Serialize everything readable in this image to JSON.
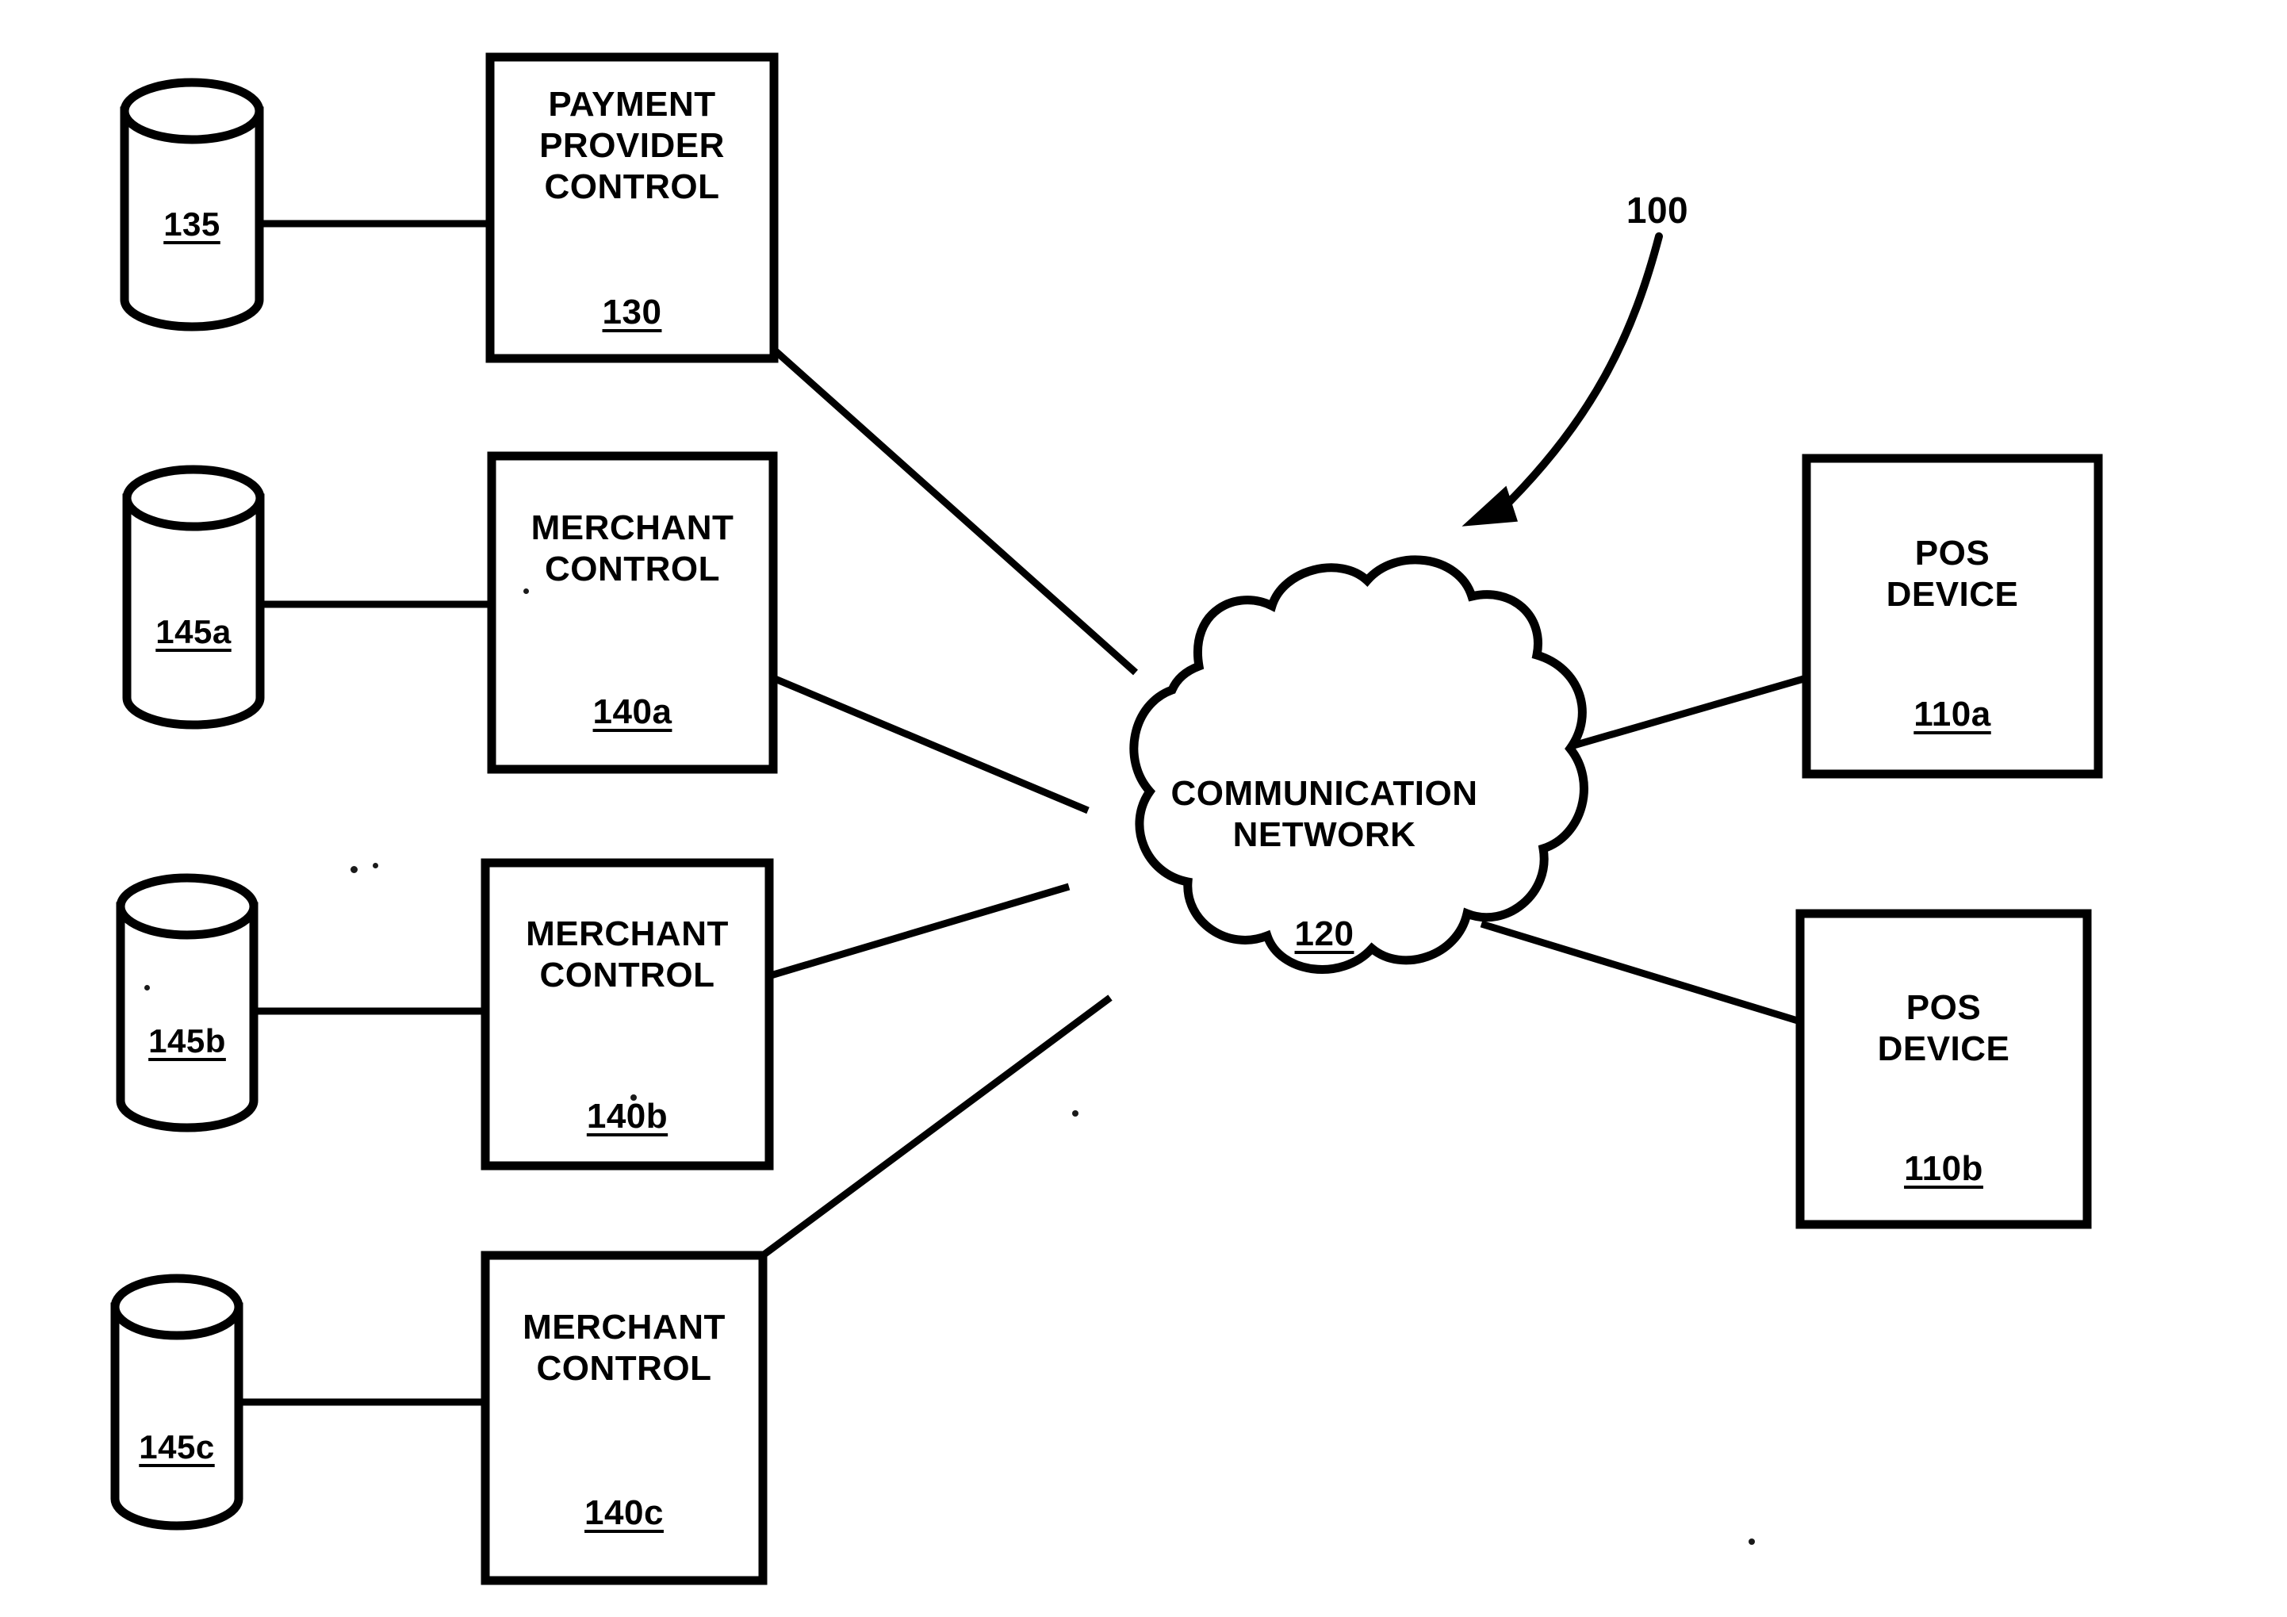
{
  "figure": {
    "reference_numeral": "100",
    "type": "system-block-diagram"
  },
  "nodes": {
    "database_135": {
      "shape": "cylinder",
      "ref": "135",
      "label": ""
    },
    "payment_provider_control": {
      "shape": "rectangle",
      "title": "PAYMENT\nPROVIDER\nCONTROL",
      "ref": "130"
    },
    "database_145a": {
      "shape": "cylinder",
      "ref": "145a",
      "label": ""
    },
    "merchant_control_a": {
      "shape": "rectangle",
      "title": "MERCHANT\nCONTROL",
      "ref": "140a"
    },
    "database_145b": {
      "shape": "cylinder",
      "ref": "145b",
      "label": ""
    },
    "merchant_control_b": {
      "shape": "rectangle",
      "title": "MERCHANT\nCONTROL",
      "ref": "140b"
    },
    "database_145c": {
      "shape": "cylinder",
      "ref": "145c",
      "label": ""
    },
    "merchant_control_c": {
      "shape": "rectangle",
      "title": "MERCHANT\nCONTROL",
      "ref": "140c"
    },
    "communication_network": {
      "shape": "cloud",
      "title": "COMMUNICATION\nNETWORK",
      "ref": "120"
    },
    "pos_device_a": {
      "shape": "rectangle",
      "title": "POS\nDEVICE",
      "ref": "110a"
    },
    "pos_device_b": {
      "shape": "rectangle",
      "title": "POS\nDEVICE",
      "ref": "110b"
    }
  },
  "connections": [
    {
      "from": "database_135",
      "to": "payment_provider_control",
      "style": "straight"
    },
    {
      "from": "payment_provider_control",
      "to": "communication_network",
      "style": "diagonal"
    },
    {
      "from": "database_145a",
      "to": "merchant_control_a",
      "style": "straight"
    },
    {
      "from": "merchant_control_a",
      "to": "communication_network",
      "style": "diagonal"
    },
    {
      "from": "database_145b",
      "to": "merchant_control_b",
      "style": "straight"
    },
    {
      "from": "merchant_control_b",
      "to": "communication_network",
      "style": "diagonal"
    },
    {
      "from": "database_145c",
      "to": "merchant_control_c",
      "style": "straight"
    },
    {
      "from": "merchant_control_c",
      "to": "communication_network",
      "style": "diagonal"
    },
    {
      "from": "communication_network",
      "to": "pos_device_a",
      "style": "diagonal"
    },
    {
      "from": "communication_network",
      "to": "pos_device_b",
      "style": "diagonal"
    }
  ],
  "colors": {
    "ink": "#000000",
    "paper": "#ffffff"
  }
}
